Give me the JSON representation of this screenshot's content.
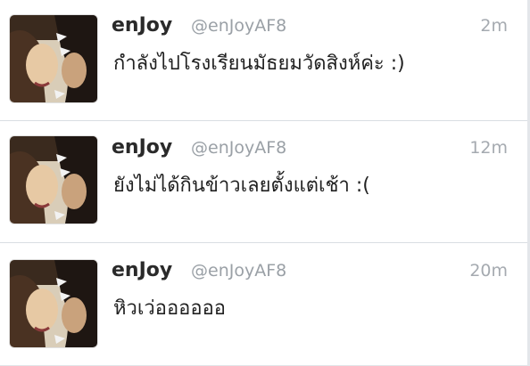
{
  "timeline": {
    "tweets": [
      {
        "display_name": "enJoy",
        "handle": "@enJoyAF8",
        "time": "2m",
        "text": "กำลังไปโรงเรียนมัธยมวัดสิงห์ค่ะ :)"
      },
      {
        "display_name": "enJoy",
        "handle": "@enJoyAF8",
        "time": "12m",
        "text": "ยังไม่ได้กินข้าวเลยตั้งแต่เช้า :("
      },
      {
        "display_name": "enJoy",
        "handle": "@enJoyAF8",
        "time": "20m",
        "text": "หิวเว่ออออออ"
      }
    ]
  },
  "colors": {
    "name": "#2a2a2a",
    "handle": "#9aa0a6",
    "divider": "#d9dde2"
  }
}
